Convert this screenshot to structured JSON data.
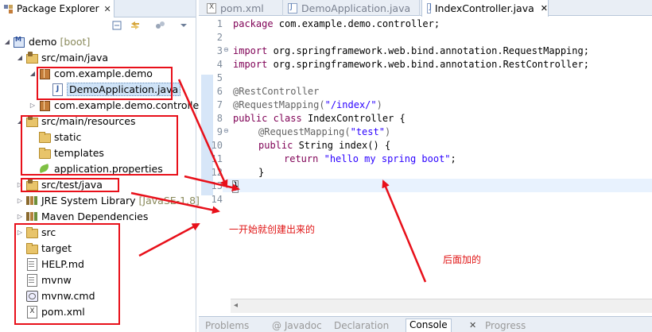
{
  "explorer": {
    "tab_title": "Package Explorer",
    "tab_close": "✕",
    "toolbar_icons": [
      "collapse-all-icon",
      "link-with-editor-icon",
      "focus-icon",
      "view-menu-icon"
    ],
    "tree": [
      {
        "label": "demo",
        "decoration": "[boot]",
        "icon": "project-icon"
      },
      {
        "label": "src/main/java",
        "icon": "source-folder-icon"
      },
      {
        "label": "com.example.demo",
        "icon": "package-icon"
      },
      {
        "label": "DemoApplication.java",
        "icon": "java-file-icon"
      },
      {
        "label": "com.example.demo.controller",
        "icon": "package-icon"
      },
      {
        "label": "src/main/resources",
        "icon": "source-folder-icon"
      },
      {
        "label": "static",
        "icon": "folder-icon"
      },
      {
        "label": "templates",
        "icon": "folder-icon"
      },
      {
        "label": "application.properties",
        "icon": "properties-file-icon"
      },
      {
        "label": "src/test/java",
        "icon": "source-folder-icon"
      },
      {
        "label": "JRE System Library",
        "decoration": "[JavaSE-1.8]",
        "icon": "library-icon"
      },
      {
        "label": "Maven Dependencies",
        "icon": "library-icon"
      },
      {
        "label": "src",
        "icon": "folder-icon"
      },
      {
        "label": "target",
        "icon": "folder-icon"
      },
      {
        "label": "HELP.md",
        "icon": "markdown-file-icon"
      },
      {
        "label": "mvnw",
        "icon": "file-icon"
      },
      {
        "label": "mvnw.cmd",
        "icon": "cmd-file-icon"
      },
      {
        "label": "pom.xml",
        "icon": "xml-file-icon"
      }
    ]
  },
  "editor": {
    "tabs": [
      {
        "label": "pom.xml",
        "icon": "xml-file-icon"
      },
      {
        "label": "DemoApplication.java",
        "icon": "java-file-icon"
      },
      {
        "label": "IndexController.java",
        "icon": "java-file-icon",
        "close": "✕"
      }
    ],
    "line_numbers": [
      "1",
      "2",
      "3",
      "4",
      "5",
      "6",
      "7",
      "8",
      "9",
      "10",
      "11",
      "12",
      "13",
      "14"
    ],
    "code": {
      "l1_kw": "package",
      "l1_rest": " com.example.demo.controller;",
      "l3_kw": "import",
      "l3_rest": " org.springframework.web.bind.annotation.RequestMapping;",
      "l4_kw": "import",
      "l4_rest": " org.springframework.web.bind.annotation.RestController;",
      "l6_ann": "@RestController",
      "l7_ann": "@RequestMapping(",
      "l7_str": "\"/index/\"",
      "l7_end": ")",
      "l8_kw1": "public",
      "l8_kw2": "class",
      "l8_rest": " IndexController {",
      "l9_ann": "@RequestMapping(",
      "l9_str": "\"test\"",
      "l9_end": ")",
      "l10_kw": "public",
      "l10_rest": " String index() {",
      "l11_kw": "return",
      "l11_str": "\"hello my spring boot\"",
      "l11_end": ";",
      "l12": "}",
      "l13": "}"
    },
    "bottom_tabs": [
      "Problems",
      "@ Javadoc",
      "Declaration",
      "Console",
      "Progress"
    ],
    "bottom_close": "✕"
  },
  "annotations": {
    "note_initial": "一开始就创建出来的",
    "note_added": "后面加的",
    "color": "#e8101a"
  }
}
